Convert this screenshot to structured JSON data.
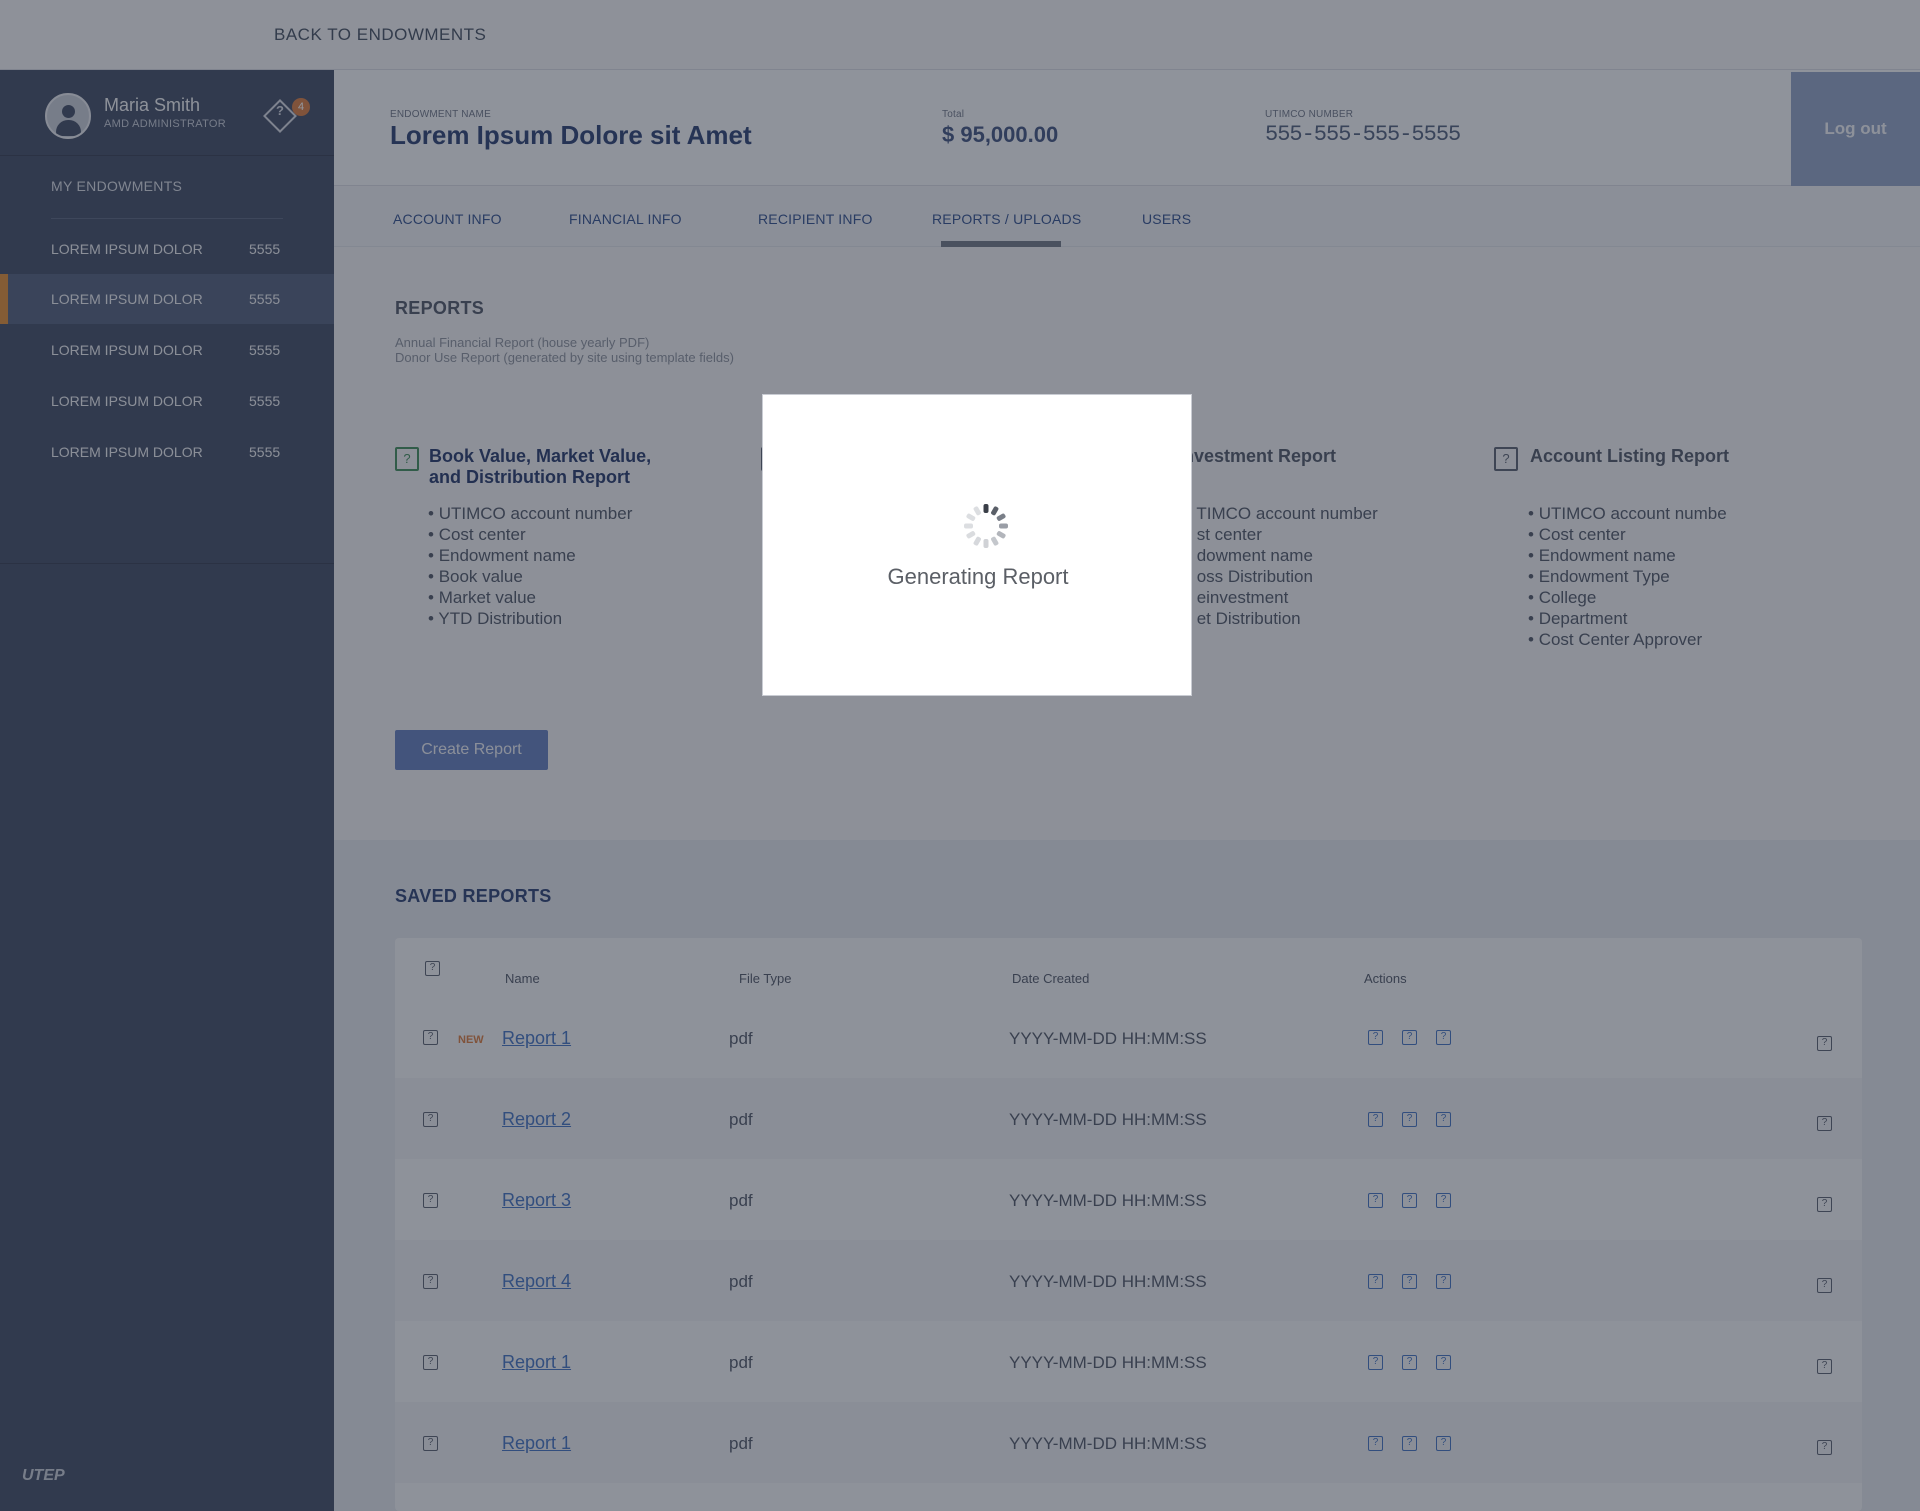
{
  "topbar": {
    "back_label": "BACK TO ENDOWMENTS"
  },
  "sidebar": {
    "user_name": "Maria Smith",
    "user_role": "AMD ADMINISTRATOR",
    "notification_count": "4",
    "section_label": "MY ENDOWMENTS",
    "items": [
      {
        "label": "LOREM IPSUM DOLOR",
        "count": "5555",
        "active": false
      },
      {
        "label": "LOREM IPSUM DOLOR",
        "count": "5555",
        "active": true
      },
      {
        "label": "LOREM IPSUM DOLOR",
        "count": "5555",
        "active": false
      },
      {
        "label": "LOREM IPSUM DOLOR",
        "count": "5555",
        "active": false
      },
      {
        "label": "LOREM IPSUM DOLOR",
        "count": "5555",
        "active": false
      }
    ],
    "footer_logo": "UTEP",
    "accent_color": "#e08a2e"
  },
  "header": {
    "endowment_label": "ENDOWMENT NAME",
    "endowment_name": "Lorem Ipsum Dolore sit Amet",
    "total_label": "Total",
    "total_value": "$ 95,000.00",
    "utimco_label": "UTIMCO NUMBER",
    "utimco_value": "555-555-555-5555",
    "logout_label": "Log out"
  },
  "tabs": [
    {
      "label": "ACCOUNT INFO",
      "active": false
    },
    {
      "label": "FINANCIAL INFO",
      "active": false
    },
    {
      "label": "RECIPIENT INFO",
      "active": false
    },
    {
      "label": "REPORTS / UPLOADS",
      "active": true
    },
    {
      "label": "USERS",
      "active": false
    }
  ],
  "reports": {
    "title": "REPORTS",
    "desc_1": "Annual Financial Report (house yearly PDF)",
    "desc_2": "Donor Use Report (generated by site using template fields)",
    "cards": [
      {
        "title_1": "Book Value, Market Value,",
        "title_2": "and Distribution Report",
        "icon": "checked-checkbox-icon",
        "bullets": [
          "UTIMCO account number",
          "Cost center",
          "Endowment name",
          "Book value",
          "Market value",
          "YTD Distribution"
        ]
      },
      {
        "title_1": "nvestment Report",
        "icon": "checkbox-icon",
        "bullets": [
          "TIMCO account number",
          "st center",
          "dowment name",
          "oss Distribution",
          "einvestment",
          "et Distribution"
        ]
      },
      {
        "title_1": "Account Listing Report",
        "icon": "checkbox-icon",
        "bullets": [
          "UTIMCO account numbe",
          "Cost center",
          "Endowment name",
          "Endowment Type",
          "College",
          "Department",
          "Cost Center Approver"
        ]
      }
    ],
    "create_button": "Create Report"
  },
  "saved_reports": {
    "title": "SAVED REPORTS",
    "columns": {
      "name": "Name",
      "file_type": "File Type",
      "date_created": "Date Created",
      "actions": "Actions"
    },
    "new_badge": "NEW",
    "rows": [
      {
        "name": "Report 1",
        "file_type": "pdf",
        "date": "YYYY-MM-DD HH:MM:SS",
        "is_new": true
      },
      {
        "name": "Report 2",
        "file_type": "pdf",
        "date": "YYYY-MM-DD HH:MM:SS",
        "is_new": false
      },
      {
        "name": "Report 3",
        "file_type": "pdf",
        "date": "YYYY-MM-DD HH:MM:SS",
        "is_new": false
      },
      {
        "name": "Report 4",
        "file_type": "pdf",
        "date": "YYYY-MM-DD HH:MM:SS",
        "is_new": false
      },
      {
        "name": "Report 1",
        "file_type": "pdf",
        "date": "YYYY-MM-DD HH:MM:SS",
        "is_new": false
      },
      {
        "name": "Report 1",
        "file_type": "pdf",
        "date": "YYYY-MM-DD HH:MM:SS",
        "is_new": false
      }
    ]
  },
  "modal": {
    "message": "Generating Report"
  }
}
